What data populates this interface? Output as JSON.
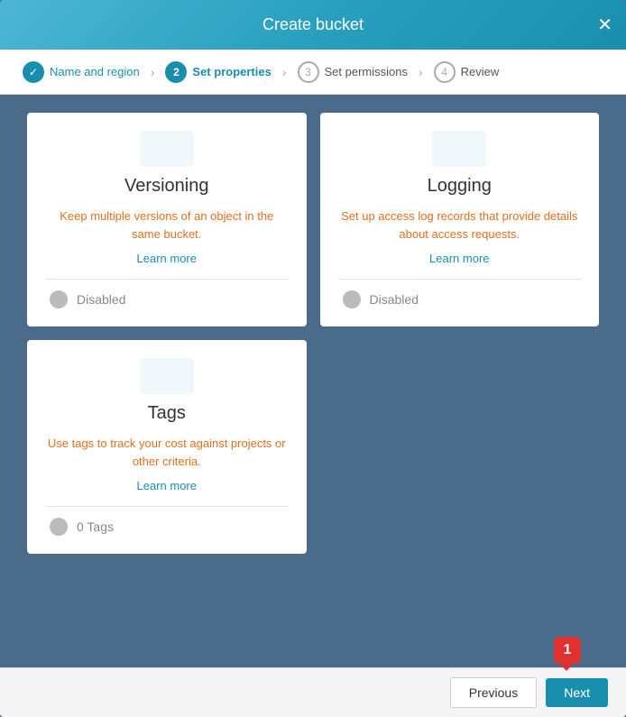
{
  "modal": {
    "title": "Create bucket",
    "close_label": "✕"
  },
  "steps": [
    {
      "id": 1,
      "label": "Name and region",
      "state": "completed",
      "circle": "✓"
    },
    {
      "id": 2,
      "label": "Set properties",
      "state": "active",
      "circle": "2"
    },
    {
      "id": 3,
      "label": "Set permissions",
      "state": "inactive",
      "circle": "3"
    },
    {
      "id": 4,
      "label": "Review",
      "state": "inactive",
      "circle": "4"
    }
  ],
  "cards": [
    {
      "id": "versioning",
      "title": "Versioning",
      "description": "Keep multiple versions of an object in the same bucket.",
      "learn_more": "Learn more",
      "toggle_label": "Disabled"
    },
    {
      "id": "logging",
      "title": "Logging",
      "description": "Set up access log records that provide details about access requests.",
      "learn_more": "Learn more",
      "toggle_label": "Disabled"
    },
    {
      "id": "tags",
      "title": "Tags",
      "description": "Use tags to track your cost against projects or other criteria.",
      "learn_more": "Learn more",
      "toggle_label": "0 Tags"
    }
  ],
  "footer": {
    "previous_label": "Previous",
    "next_label": "Next",
    "badge_count": "1"
  }
}
